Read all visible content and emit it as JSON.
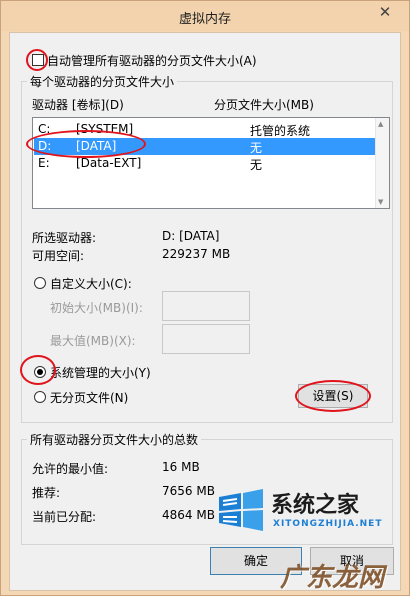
{
  "window": {
    "title": "虚拟内存",
    "close_glyph": "✕"
  },
  "auto_manage": {
    "label": "自动管理所有驱动器的分页文件大小(A)",
    "checked": false
  },
  "drives_group": {
    "title": "每个驱动器的分页文件大小",
    "col_drive": "驱动器 [卷标](D)",
    "col_size": "分页文件大小(MB)",
    "rows": [
      {
        "letter": "C:",
        "label": "[SYSTEM]",
        "size": "托管的系统",
        "selected": false
      },
      {
        "letter": "D:",
        "label": "[DATA]",
        "size": "无",
        "selected": true
      },
      {
        "letter": "E:",
        "label": "[Data-EXT]",
        "size": "无",
        "selected": false
      }
    ],
    "selected_drive_label": "所选驱动器:",
    "selected_drive_value": "D:  [DATA]",
    "free_space_label": "可用空间:",
    "free_space_value": "229237 MB",
    "custom_size_label": "自定义大小(C):",
    "initial_size_label": "初始大小(MB)(I):",
    "max_size_label": "最大值(MB)(X):",
    "system_managed_label": "系统管理的大小(Y)",
    "no_paging_label": "无分页文件(N)",
    "set_button": "设置(S)",
    "selected_radio": "system_managed"
  },
  "total_group": {
    "title": "所有驱动器分页文件大小的总数",
    "min_label": "允许的最小值:",
    "min_value": "16 MB",
    "recommended_label": "推荐:",
    "recommended_value": "7656 MB",
    "current_label": "当前已分配:",
    "current_value": "4864 MB"
  },
  "buttons": {
    "ok": "确定",
    "cancel": "取消"
  },
  "watermarks": {
    "site1_name": "系统之家",
    "site1_url": "XITONGZHIJIA.NET",
    "site2_name": "广东龙网"
  },
  "colors": {
    "highlight": "#3399ff",
    "annotation_red": "#e0141c",
    "title_bar": "#f2d3ad",
    "watermark_blue": "#1c7fd6"
  }
}
